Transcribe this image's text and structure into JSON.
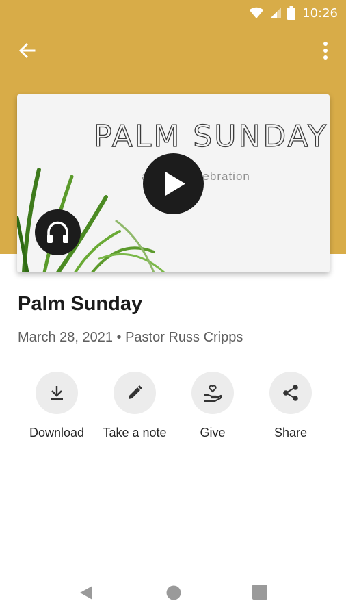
{
  "status_bar": {
    "time": "10:26"
  },
  "toolbar": {
    "back_icon": "arrow-back-icon",
    "more_icon": "more-vert-icon"
  },
  "colors": {
    "header": "#d8ac48",
    "icon_circle": "#ececec",
    "dark_button": "#1c1c1c"
  },
  "thumbnail": {
    "title": "PALM SUNDAY",
    "subtitle": "a fresh celebration",
    "play_icon": "play-icon",
    "audio_icon": "headphones-icon"
  },
  "sermon": {
    "title": "Palm Sunday",
    "meta": "March 28, 2021 • Pastor Russ Cripps"
  },
  "actions": [
    {
      "label": "Download",
      "icon": "download-icon"
    },
    {
      "label": "Take a note",
      "icon": "pencil-icon"
    },
    {
      "label": "Give",
      "icon": "give-hand-heart-icon"
    },
    {
      "label": "Share",
      "icon": "share-icon"
    }
  ],
  "nav_bar": {
    "back": "nav-back-icon",
    "home": "nav-home-icon",
    "recents": "nav-recents-icon"
  }
}
